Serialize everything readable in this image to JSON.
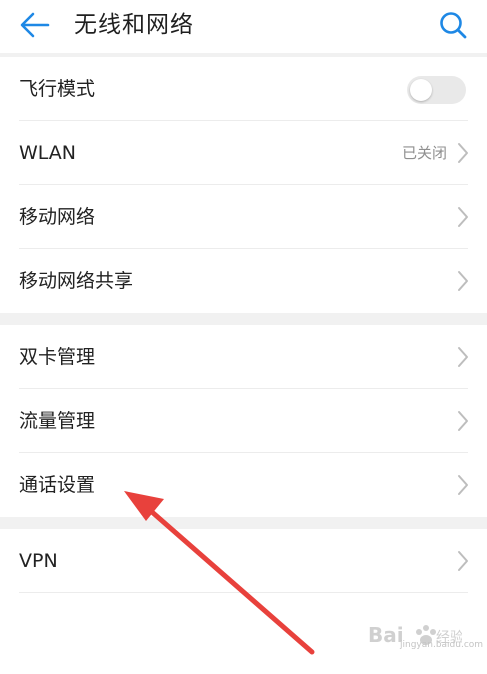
{
  "appbar": {
    "title": "无线和网络",
    "back_icon": "back-arrow-icon",
    "search_icon": "search-icon",
    "accent_color": "#1e88e5"
  },
  "sections": [
    {
      "items": [
        {
          "label": "飞行模式",
          "control": "toggle",
          "toggle_on": false
        },
        {
          "label": "WLAN",
          "status": "已关闭",
          "control": "chevron"
        },
        {
          "label": "移动网络",
          "control": "chevron"
        },
        {
          "label": "移动网络共享",
          "control": "chevron"
        }
      ]
    },
    {
      "items": [
        {
          "label": "双卡管理",
          "control": "chevron"
        },
        {
          "label": "流量管理",
          "control": "chevron"
        },
        {
          "label": "通话设置",
          "control": "chevron"
        }
      ]
    },
    {
      "items": [
        {
          "label": "VPN",
          "control": "chevron"
        }
      ]
    }
  ],
  "annotation": {
    "arrow_color": "#e8413c",
    "points_to": "通话设置"
  },
  "watermark": {
    "text": "jingyan.baidu.com",
    "icon": "baidu-jingyan-logo-icon"
  }
}
